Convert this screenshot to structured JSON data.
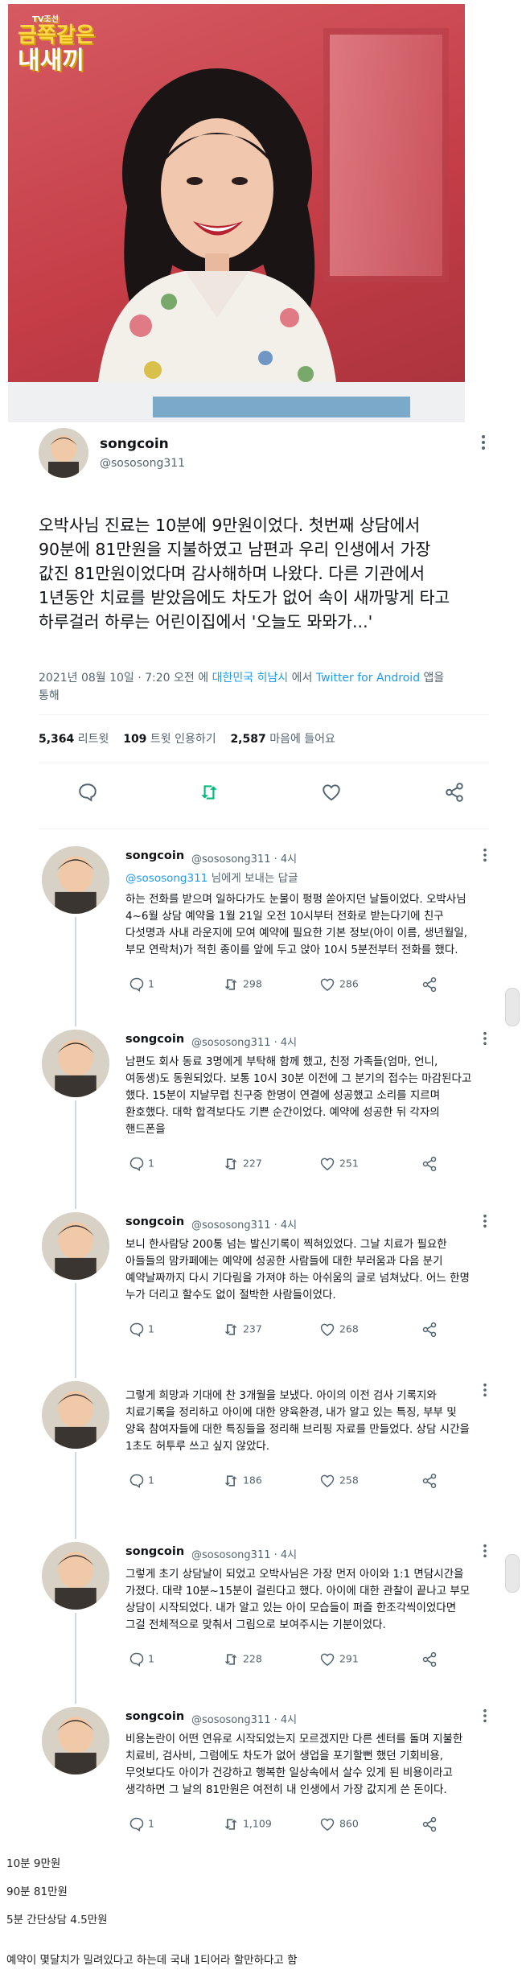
{
  "hero": {
    "logo_badge": "TV조선",
    "logo_line1": "금쪽같은",
    "logo_line2": "내새끼"
  },
  "tweet": {
    "display_name": "songcoin",
    "handle": "@sososong311",
    "text_lines": [
      "오박사님 진료는 10분에 9만원이었다. 첫번째 상담에서",
      "90분에 81만원을 지불하였고 남편과 우리 인생에서 가장",
      "값진 81만원이었다며 감사해하며 나왔다. 다른 기관에서",
      "1년동안 치료를 받았음에도 차도가 없어 속이 새까맣게 타고",
      "하루걸러 하루는 어린이집에서 '오늘도 뫄뫄가...'"
    ],
    "meta_time": "2021년 08월 10일 · 7:20 오전 에 ",
    "meta_location": "대한민국 히남시",
    "meta_via": " 에서 ",
    "meta_client": "Twitter for Android",
    "meta_tail": " 앱을",
    "meta_tail2": "통해",
    "retweets": "5,364",
    "retweets_label": "리트윗",
    "quotes": "109",
    "quotes_label": "트윗 인용하기",
    "likes": "2,587",
    "likes_label": "마음에 들어요"
  },
  "replies": [
    {
      "name": "songcoin",
      "handle": "@sososong311 · 4시",
      "reply_to_handle": "@sososong311",
      "reply_to_suffix": " 님에게 보내는 답글",
      "lines": [
        "하는 전화를 받으며 일하다가도 눈물이 펑펑 쏟아지던 날들이었다. 오박사님",
        "4~6월 상담 예약을 1월 21일 오전 10시부터 전화로 받는다기에 친구",
        "다섯명과 사내 라운지에 모여 예약에 필요한 기본 정보(아이 이름, 생년월일,",
        "부모 연락처)가 적힌 종이를 앞에 두고 앉아 10시 5분전부터 전화를 했다."
      ],
      "reply": "1",
      "rt": "298",
      "like": "286"
    },
    {
      "name": "songcoin",
      "handle": "@sososong311 · 4시",
      "lines": [
        "남편도 회사 동료 3명에게 부탁해 함께 했고, 친정 가족들(엄마, 언니,",
        "여동생)도 동원되었다. 보통 10시 30분 이전에 그 분기의 접수는 마감된다고",
        "했다. 15분이 지날무렵 친구중 한명이 연결에 성공했고 소리를 지르며",
        "환호했다. 대학 합격보다도 기쁜 순간이었다. 예약에 성공한 뒤 각자의",
        "핸드폰을"
      ],
      "reply": "1",
      "rt": "227",
      "like": "251"
    },
    {
      "name": "songcoin",
      "handle": "@sososong311 · 4시",
      "lines": [
        "보니 한사람당 200통 넘는 발신기록이 찍혀있었다. 그날 치료가 필요한",
        "아들들의 맘카페에는 예약에 성공한 사람들에 대한 부러움과 다음 분기",
        "예약날짜까지 다시 기다림을 가져야 하는 아쉬움의 글로 넘쳐났다. 어느 한명",
        "누가 더리고 할수도 없이 절박한 사람들이었다."
      ],
      "reply": "1",
      "rt": "237",
      "like": "268"
    },
    {
      "name": "",
      "handle": "",
      "lines": [
        "그렇게 희망과 기대에 찬 3개월을 보냈다. 아이의 이전 검사 기록지와",
        "치료기록을 정리하고 아이에 대한 양육환경, 내가 알고 있는 특징, 부부 및",
        "양육 참여자들에 대한 특징들을 정리해 브리핑 자료를 만들었다. 상담 시간을",
        "1초도 허투루 쓰고 싶지 않았다."
      ],
      "reply": "1",
      "rt": "186",
      "like": "258"
    },
    {
      "name": "songcoin",
      "handle": "@sososong311 · 4시",
      "lines": [
        "그렇게 초기 상담날이 되었고 오박사님은 가장 먼저 아이와 1:1 면담시간을",
        "가졌다. 대략 10분~15분이 걸린다고 했다. 아이에 대한 관찰이 끝나고 부모",
        "상담이 시작되었다. 내가 알고 있는 아이 모습들이 퍼즐 한조각씩이었다면",
        "그걸 전체적으로 맞춰서 그림으로 보여주시는 기분이었다."
      ],
      "reply": "1",
      "rt": "228",
      "like": "291"
    },
    {
      "name": "songcoin",
      "handle": "@sososong311 · 4시",
      "lines": [
        "비용논란이 어떤 연유로 시작되었는지 모르겠지만 다른 센터를 돌며 지불한",
        "치료비, 검사비, 그럼에도 차도가 없어 생업을 포기할뻔 했던 기회비용,",
        "무엇보다도 아이가 건강하고 행복한 일상속에서 살수 있게 된 비용이라고",
        "생각하면 그 날의 81만원은 여전히 내 인생에서 가장 값지게 쓴 돈이다."
      ],
      "reply": "1",
      "rt": "1,109",
      "like": "860"
    }
  ],
  "footer": {
    "line1": "10분 9만원",
    "line2": "90분 81만원",
    "line3": "5분 간단상담 4.5만원",
    "line4": "예약이 몇달치가 밀려있다고 하는데 국내 1티어라 할만하다고 함"
  },
  "colors": {
    "accent_blue": "#1d9bf0",
    "retweet_green": "#00ba7c",
    "text_primary": "#0f1419",
    "text_secondary": "#536471"
  },
  "icons": [
    "reply-icon",
    "retweet-icon",
    "like-icon",
    "share-icon",
    "more-icon"
  ]
}
